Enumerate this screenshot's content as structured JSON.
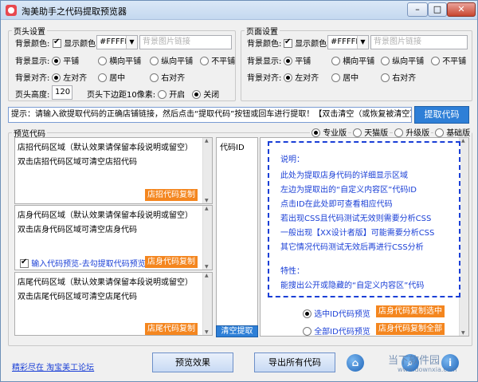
{
  "window": {
    "title": "淘美助手之代码提取预览器",
    "minimize": "–",
    "maximize": "□",
    "close": "✕"
  },
  "header_settings": {
    "legend": "页头设置",
    "bg_color_label": "背景颜色:",
    "show_color": "显示颜色",
    "color_value": "#FFFFFF",
    "bg_image_placeholder": "背景图片链接",
    "bg_display_label": "背景显示:",
    "display_options": [
      "平铺",
      "横向平铺",
      "纵向平铺",
      "不平铺"
    ],
    "bg_align_label": "背景对齐:",
    "align_options": [
      "左对齐",
      "居中",
      "右对齐"
    ],
    "height_label": "页头高度:",
    "height_value": "120",
    "margin_label": "页头下边距10像素:",
    "margin_options": [
      "开启",
      "关闭"
    ]
  },
  "page_settings": {
    "legend": "页面设置",
    "bg_color_label": "背景颜色:",
    "show_color": "显示颜色",
    "color_value": "#FFFFFF",
    "bg_image_placeholder": "背景图片链接",
    "bg_display_label": "背景显示:",
    "display_options": [
      "平铺",
      "横向平铺",
      "纵向平铺",
      "不平铺"
    ],
    "bg_align_label": "背景对齐:",
    "align_options": [
      "左对齐",
      "居中",
      "右对齐"
    ]
  },
  "url_bar": {
    "value": "提示：请输入欲提取代码的正确店铺链接，然后点击“提取代码”按钮或回车进行提取！【双击清空（或恢复被清空）】",
    "extract_button": "提取代码"
  },
  "preview": {
    "legend": "预览代码",
    "versions": [
      "专业版",
      "天猫版",
      "升级版",
      "基础版"
    ]
  },
  "shop_header": {
    "title": "店招代码区域（默认效果请保留本段说明或留空）",
    "hint": "双击店招代码区域可清空店招代码",
    "copy": "店招代码复制"
  },
  "shop_body": {
    "title": "店身代码区域（默认效果请保留本段说明或留空）",
    "hint": "双击店身代码区域可清空店身代码",
    "checkbox": "输入代码预览-去勾提取代码预览",
    "copy": "店身代码复制"
  },
  "shop_footer": {
    "title": "店尾代码区域（默认效果请保留本段说明或留空）",
    "hint": "双击店尾代码区域可清空店尾代码",
    "copy": "店尾代码复制"
  },
  "code_id": {
    "header": "代码ID",
    "clear": "清空提取"
  },
  "info": {
    "lines": [
      "说明：",
      "此处为提取店身代码的详细显示区域",
      "左边为提取出的“自定义内容区”代码ID",
      "点击ID在此处即可查看相应代码",
      "若出现CSS且代码测试无效则需要分析CSS",
      "一般出现【XX设计者版】可能需要分析CSS",
      "其它情况代码测试无效后再进行CSS分析",
      "特性：",
      "能搜出公开或隐藏的“自定义内容区”代码"
    ]
  },
  "selection": {
    "preview_selected": "选中ID代码预览",
    "copy_selected": "店身代码复制选中",
    "preview_all": "全部ID代码预览",
    "copy_all": "店身代码复制全部"
  },
  "footer": {
    "link": "精彩尽在 淘宝美工论坛",
    "preview_button": "预览效果",
    "export_button": "导出所有代码",
    "icons": [
      "home-icon",
      "search-icon",
      "info-icon"
    ],
    "watermark": "当下软件园",
    "watermark_url": "www.downxia.com"
  }
}
